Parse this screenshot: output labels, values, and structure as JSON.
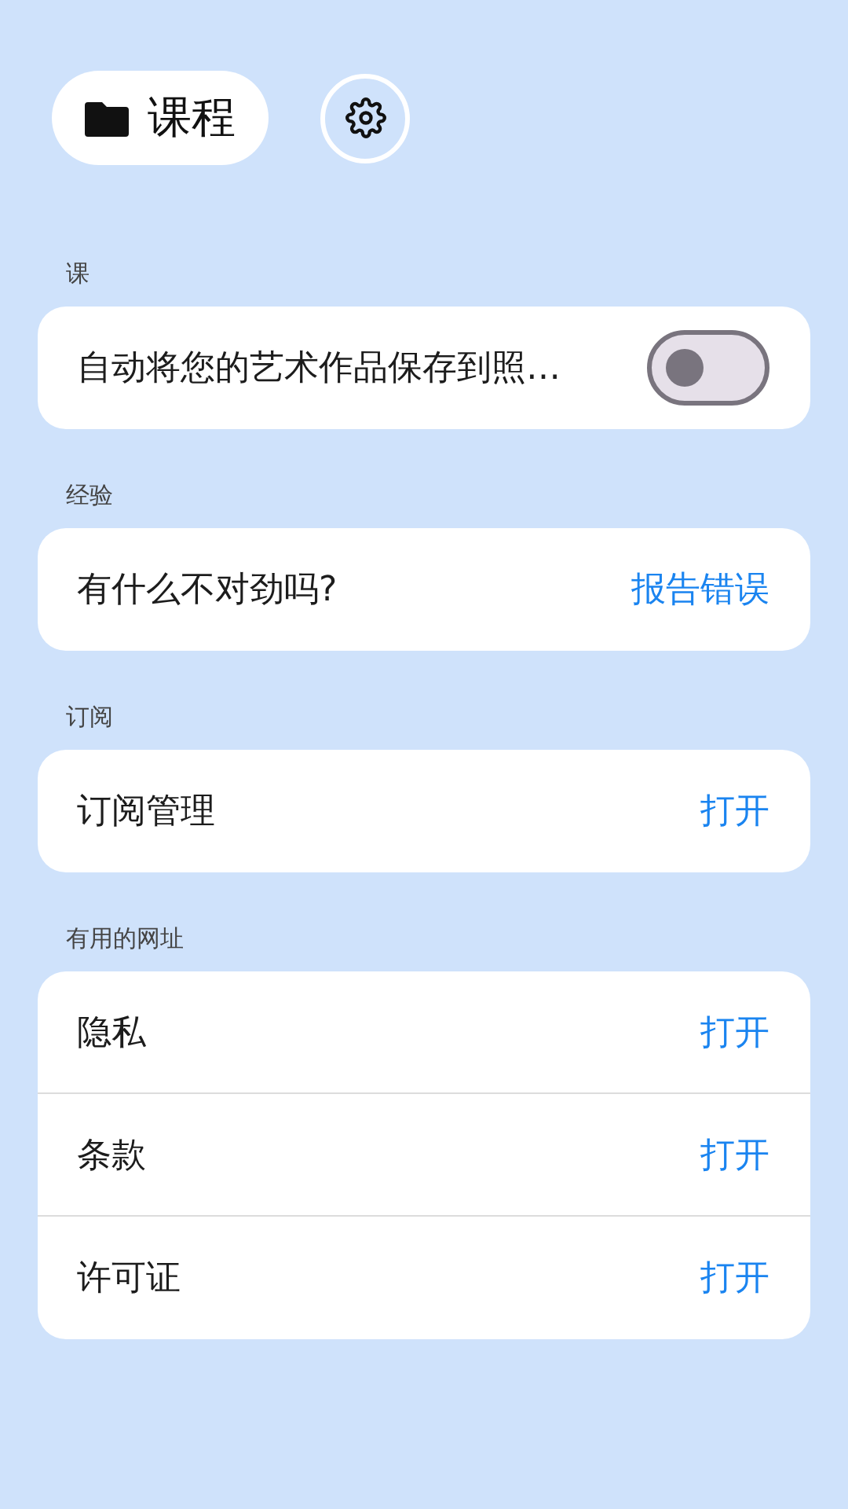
{
  "header": {
    "title": "课程"
  },
  "sections": [
    {
      "label": "课",
      "rows": [
        {
          "kind": "toggle",
          "text": "自动将您的艺术作品保存到照…",
          "on": false
        }
      ]
    },
    {
      "label": "经验",
      "rows": [
        {
          "kind": "action",
          "text": "有什么不对劲吗?",
          "action": "报告错误"
        }
      ]
    },
    {
      "label": "订阅",
      "rows": [
        {
          "kind": "action",
          "text": "订阅管理",
          "action": "打开"
        }
      ]
    },
    {
      "label": "有用的网址",
      "rows": [
        {
          "kind": "action",
          "text": "隐私",
          "action": "打开"
        },
        {
          "kind": "action",
          "text": "条款",
          "action": "打开"
        },
        {
          "kind": "action",
          "text": "许可证",
          "action": "打开"
        }
      ]
    }
  ]
}
